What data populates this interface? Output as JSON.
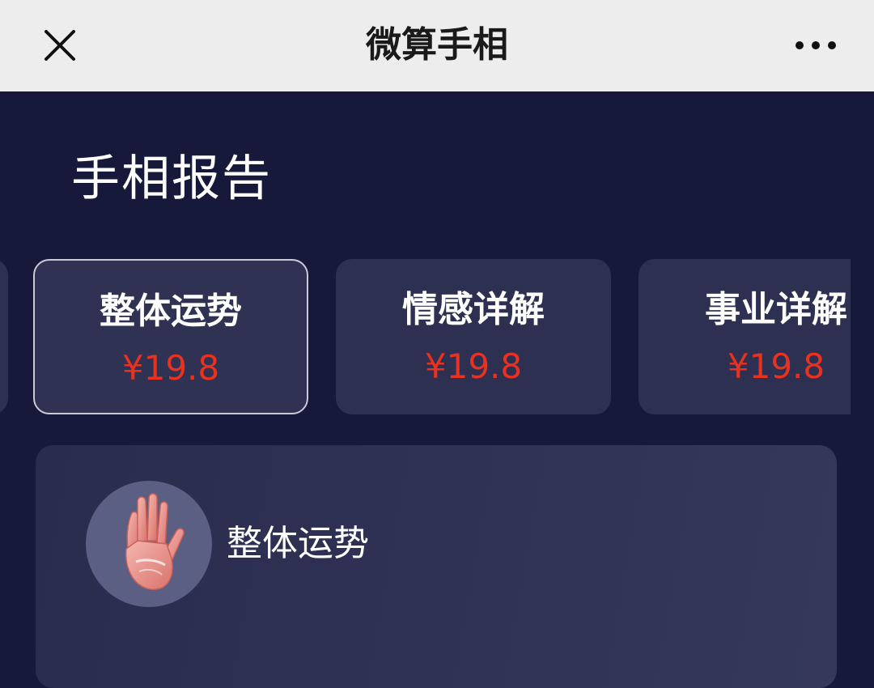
{
  "header": {
    "title": "微算手相",
    "close_icon": "close-icon",
    "more_icon": "more-dots-icon",
    "background": "#ededed"
  },
  "page": {
    "heading": "手相报告",
    "background": "#17193b"
  },
  "tabs": [
    {
      "label": "整体运势",
      "price": "¥19.8",
      "active": true
    },
    {
      "label": "情感详解",
      "price": "¥19.8",
      "active": false
    },
    {
      "label": "事业详解",
      "price": "¥19.8",
      "active": false
    }
  ],
  "colors": {
    "price": "#e8321f",
    "card": "#2d3050",
    "active_border": "#c8cad6"
  },
  "detail": {
    "title": "整体运势",
    "avatar_icon": "palm-hand-icon"
  }
}
